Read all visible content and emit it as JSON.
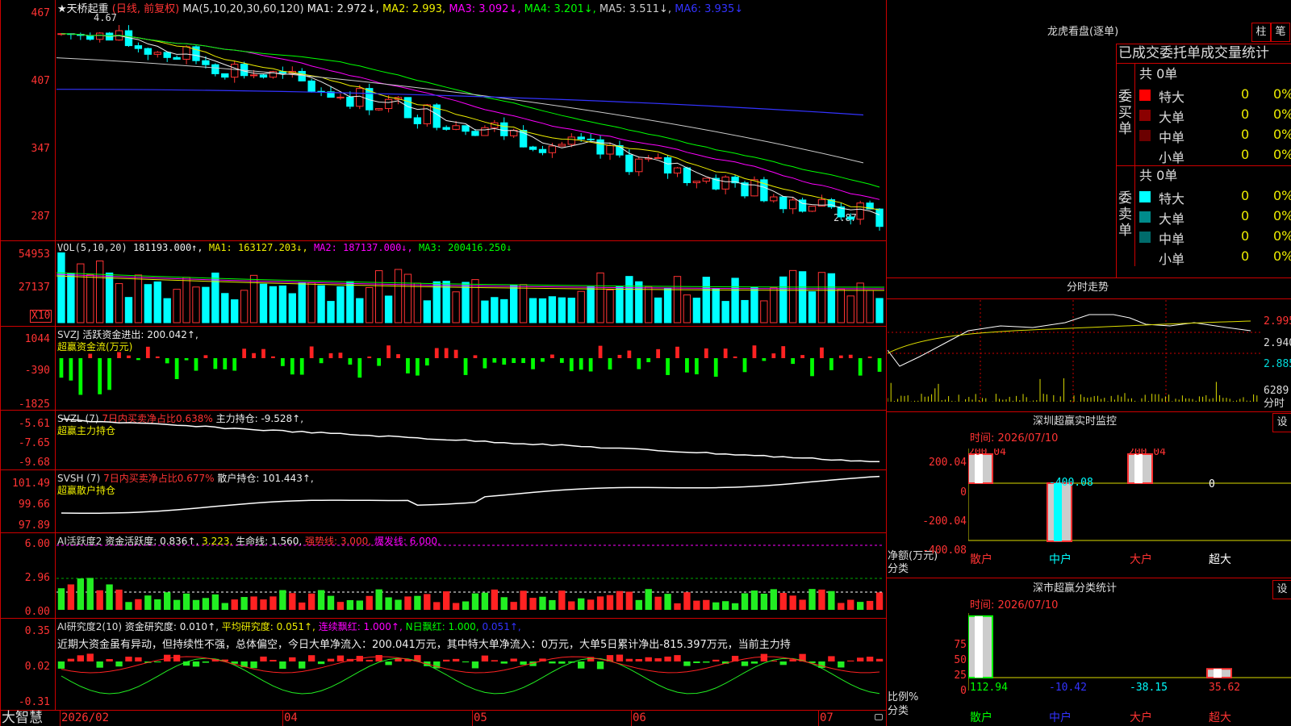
{
  "stock": {
    "title": "★天桥起重",
    "mode": "(日线, 前复权)",
    "ma_label": "MA(5,10,20,30,60,120)",
    "ma1": "MA1: 2.972↓,",
    "ma2": "MA2: 2.993,",
    "ma3": "MA3: 3.092↓,",
    "ma4": "MA4: 3.201↓,",
    "ma5": "MA5: 3.511↓,",
    "ma6": "MA6: 3.935↓",
    "high_mark": "4.67",
    "low_mark": "2.87→",
    "y_ticks": [
      "467",
      "407",
      "347",
      "287"
    ]
  },
  "vol": {
    "label": "VOL(5,10,20)",
    "value": "181193.000↑,",
    "ma1": "MA1: 163127.203↓,",
    "ma2": "MA2: 187137.000↓,",
    "ma3": "MA3: 200416.250↓",
    "y_ticks": [
      "54953",
      "27137"
    ],
    "unit": "X10"
  },
  "svzj": {
    "label": "SVZJ",
    "line1": "活跃资金进出: 200.042↑,",
    "line2": "超赢资金流(万元)",
    "y_ticks": [
      "1044",
      "-390",
      "-1825"
    ]
  },
  "svzl": {
    "label": "SVZL (7)",
    "line1": "7日内买卖净占比0.638%",
    "line1b": "主力持仓: -9.528↑,",
    "line2": "超赢主力持仓",
    "y_ticks": [
      "-5.61",
      "-7.65",
      "-9.68"
    ]
  },
  "svsh": {
    "label": "SVSH (7)",
    "line1": "7日内买卖净占比0.677%",
    "line1b": "散户持仓: 101.443↑,",
    "line2": "超赢散户持仓",
    "y_ticks": [
      "101.49",
      "99.66",
      "97.89"
    ]
  },
  "ai1": {
    "label": "AI活跃度2",
    "v1": "资金活跃度: 0.836↑,",
    "v2": "3.223,",
    "v3": "生命线: 1.560,",
    "v4": "强势线: 3.000,",
    "v5": "爆发线: 6.000,",
    "y_ticks": [
      "6.00",
      "2.96",
      "0.00"
    ]
  },
  "ai2": {
    "label": "AI研究度2(10)",
    "v1": "资金研究度: 0.010↑,",
    "v2": "平均研究度: 0.051↑,",
    "v3": "连续飘红: 1.000↑,",
    "v4": "N日飘红: 1.000,",
    "v5": "0.051↑,",
    "text": "近期大资金虽有异动，但持续性不强，总体偏空，今日大单净流入：200.041万元，其中特大单净流入：0万元，大单5日累计净出-815.397万元，当前主力持",
    "y_ticks": [
      "0.35",
      "0.02",
      "-0.31"
    ]
  },
  "footer": {
    "brand": "大智慧",
    "dates": [
      "2026/02",
      "04",
      "05",
      "06",
      "07"
    ]
  },
  "right": {
    "header": "龙虎看盘(逐单)",
    "btn1": "柱",
    "btn2": "笔",
    "subheader": "已成交委托单成交量统计",
    "buy_label": "委买单",
    "sell_label": "委卖单",
    "buy_total": "共 0单",
    "sell_total": "共 0单",
    "buy_rows": [
      {
        "name": "特大",
        "count": "0",
        "pct": "0%",
        "color": "#ff0000"
      },
      {
        "name": "大单",
        "count": "0",
        "pct": "0%",
        "color": "#8b0000"
      },
      {
        "name": "中单",
        "count": "0",
        "pct": "0%",
        "color": "#6b0000"
      },
      {
        "name": "小单",
        "count": "0",
        "pct": "0%",
        "color": "#000000"
      }
    ],
    "sell_rows": [
      {
        "name": "特大",
        "count": "0",
        "pct": "0%",
        "color": "#00ffff"
      },
      {
        "name": "大单",
        "count": "0",
        "pct": "0%",
        "color": "#008b8b"
      },
      {
        "name": "中单",
        "count": "0",
        "pct": "0%",
        "color": "#006b6b"
      },
      {
        "name": "小单",
        "count": "0",
        "pct": "0%",
        "color": "#000000"
      }
    ],
    "intraday_title": "分时走势",
    "intraday_ticks": [
      "2.995",
      "2.940",
      "2.885"
    ],
    "intraday_vol": "6289",
    "intraday_vol_label": "分时",
    "monitor_title": "深圳超赢实时监控",
    "monitor_btn": "设",
    "monitor_time": "时间: 2026/07/10",
    "monitor_ticks": [
      "200.04",
      "0",
      "-200.04",
      "-400.08"
    ],
    "monitor_ylabel": "净额(万元)",
    "monitor_xlabel": "分类",
    "monitor_values": [
      "200.04",
      "-400.08",
      "200.04",
      "0"
    ],
    "categories": [
      "散户",
      "中户",
      "大户",
      "超大"
    ],
    "class_title": "深市超赢分类统计",
    "class_btn": "设",
    "class_time": "时间: 2026/07/10",
    "class_ticks": [
      "75",
      "50",
      "25",
      "0"
    ],
    "class_ylabel": "比例%",
    "class_xlabel": "分类",
    "class_values": [
      "112.94",
      "-10.42",
      "-38.15",
      "35.62"
    ]
  }
}
